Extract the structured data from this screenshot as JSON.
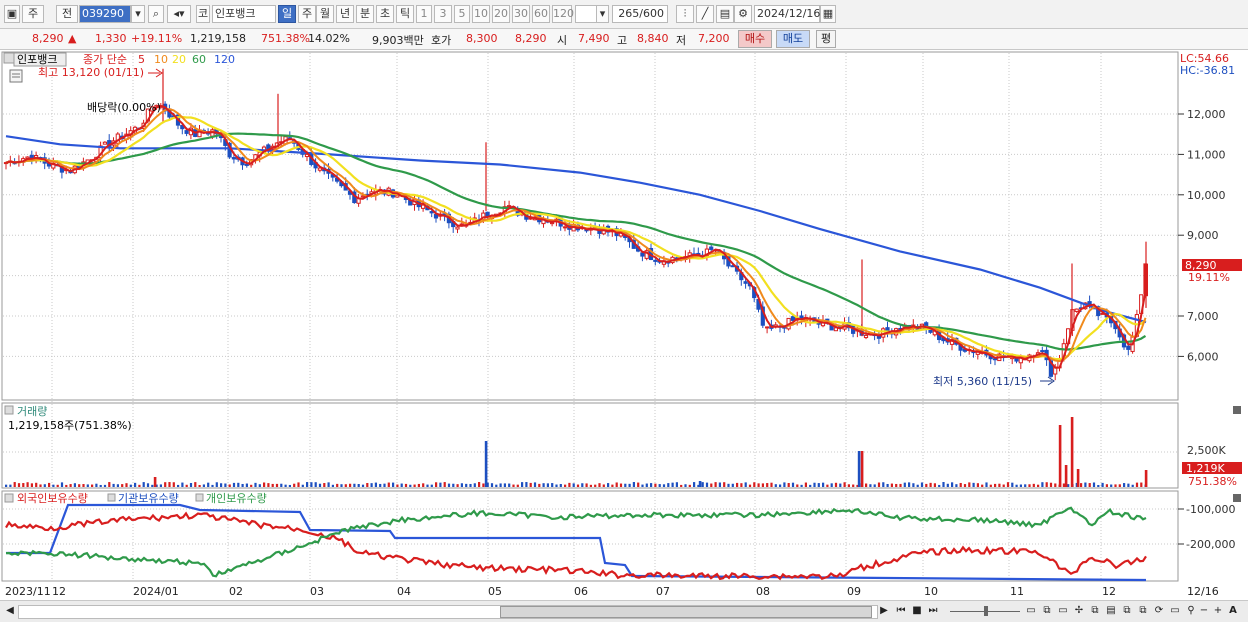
{
  "toolbar": {
    "market_label": "주",
    "prev_label": "전",
    "code_value": "039290",
    "stock_prefix": "코",
    "stock_name": "인포뱅크",
    "periods": [
      "일",
      "주",
      "월",
      "년",
      "분",
      "초",
      "틱"
    ],
    "selected_period": "일",
    "intervals": [
      "1",
      "3",
      "5",
      "10",
      "20",
      "30",
      "60",
      "120"
    ],
    "count_display": "265/600",
    "date_value": "2024/12/16"
  },
  "quote": {
    "price": "8,290",
    "change": "1,330",
    "change_pct": "+19.11%",
    "volume": "1,219,158",
    "volume_ratio": "751.38%",
    "turnover": "14.02%",
    "amount": "9,903백만",
    "hoga_label": "호가",
    "ask": "8,300",
    "bid": "8,290",
    "open_label": "시",
    "open": "7,490",
    "high_label": "고",
    "high": "8,840",
    "low_label": "저",
    "low": "7,200",
    "buy_label": "매수",
    "sell_label": "매도",
    "eval_label": "평"
  },
  "price_panel": {
    "stock_tab": "인포뱅크",
    "ma_legend_prefix": "종가 단순",
    "ma_periods": [
      "5",
      "10",
      "20",
      "60",
      "120"
    ],
    "ma_colors": [
      "#d81e1e",
      "#f08a1c",
      "#f2e020",
      "#2f9a4a",
      "#2b56d8"
    ],
    "high_note": "최고 13,120 (01/11)",
    "low_note": "최저 5,360 (11/15)",
    "dividend_note": "배당락(0.00%)",
    "lc": "LC:54.66",
    "hc": "HC:-36.81",
    "y_ticks": [
      "12,000",
      "11,000",
      "10,000",
      "9,000",
      "7,000",
      "6,000"
    ],
    "last_price_tag": "8,290",
    "last_pct_tag": "19.11%"
  },
  "volume_panel": {
    "title": "거래량",
    "subtitle": "1,219,158주(751.38%)",
    "y_tick": "2,500K",
    "last_tag": "1,219K",
    "last_pct": "751.38%"
  },
  "holding_panel": {
    "series": [
      "외국인보유수량",
      "기관보유수량",
      "개인보유수량"
    ],
    "y_ticks": [
      "-100,000",
      "-200,000"
    ]
  },
  "x_axis": [
    "2023/11",
    "12",
    "2024/01",
    "02",
    "03",
    "04",
    "05",
    "06",
    "07",
    "08",
    "09",
    "10",
    "11",
    "12",
    "12/16"
  ],
  "chart_data": {
    "type": "line",
    "title": "인포뱅크",
    "x": [
      "2023/11",
      "12",
      "2024/01",
      "02",
      "03",
      "04",
      "05",
      "06",
      "07",
      "08",
      "09",
      "10",
      "11",
      "12",
      "12/16"
    ],
    "series": [
      {
        "name": "종가",
        "values": [
          10850,
          11050,
          12000,
          11000,
          11200,
          9900,
          9900,
          9200,
          8600,
          6700,
          6500,
          6100,
          5700,
          6900,
          8290
        ]
      },
      {
        "name": "120",
        "values": [
          11400,
          11200,
          11100,
          11100,
          11050,
          10950,
          10800,
          10500,
          10150,
          9600,
          8950,
          8250,
          7700,
          7000,
          6850
        ]
      }
    ],
    "ylim": [
      5300,
      13200
    ],
    "high": 13120,
    "low": 5360,
    "volume_last": 1219158
  }
}
